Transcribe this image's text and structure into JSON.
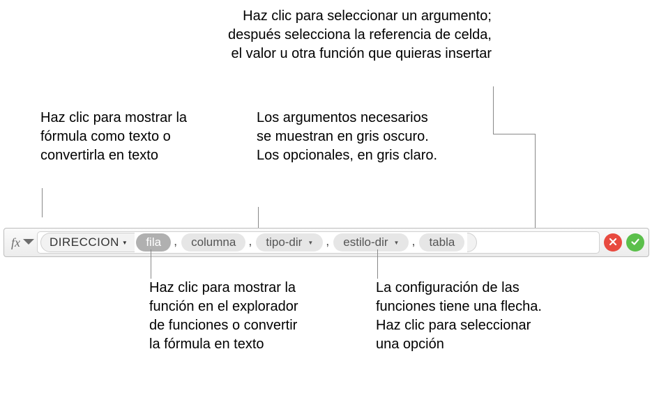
{
  "callouts": {
    "top_right": "Haz clic para seleccionar un argumento; después selecciona la referencia de celda, el valor u otra función que quieras insertar",
    "top_left": "Haz clic para mostrar la fórmula como texto o convertirla en texto",
    "top_center": "Los argumentos necesarios se muestran en gris oscuro. Los opcionales, en gris claro.",
    "bottom_left": "Haz clic para mostrar la función en el explorador de funciones o convertir la fórmula en texto",
    "bottom_right": "La configuración de las funciones tiene una flecha. Haz clic para seleccionar una opción"
  },
  "formula": {
    "fx_label": "fx",
    "function_name": "DIRECCION",
    "tokens": [
      {
        "label": "fila",
        "style": "dark",
        "has_dropdown": false
      },
      {
        "label": "columna",
        "style": "light",
        "has_dropdown": false
      },
      {
        "label": "tipo-dir",
        "style": "light",
        "has_dropdown": true
      },
      {
        "label": "estilo-dir",
        "style": "light",
        "has_dropdown": true
      },
      {
        "label": "tabla",
        "style": "light",
        "has_dropdown": false
      }
    ],
    "separator": ","
  }
}
